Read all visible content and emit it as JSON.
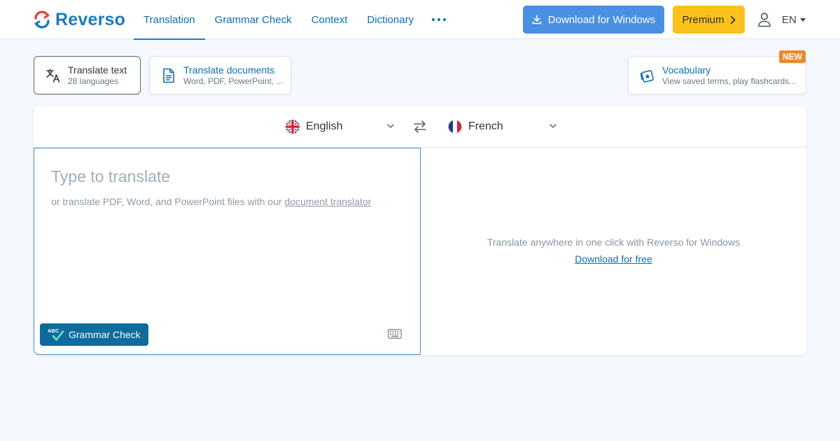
{
  "header": {
    "logo_text": "Reverso",
    "nav": [
      {
        "label": "Translation",
        "active": true
      },
      {
        "label": "Grammar Check",
        "active": false
      },
      {
        "label": "Context",
        "active": false
      },
      {
        "label": "Dictionary",
        "active": false
      }
    ],
    "more_icon": "ellipsis-icon",
    "download_label": "Download for Windows",
    "premium_label": "Premium",
    "ui_language": "EN"
  },
  "modes": {
    "text": {
      "title": "Translate text",
      "subtitle": "28 languages"
    },
    "documents": {
      "title": "Translate documents",
      "subtitle": "Word, PDF, PowerPoint, ..."
    },
    "vocabulary": {
      "title": "Vocabulary",
      "subtitle": "View saved terms, play flashcards...",
      "badge": "NEW"
    }
  },
  "translator": {
    "source_language": "English",
    "target_language": "French",
    "placeholder": "Type to translate",
    "hint_prefix": "or translate PDF, Word, and PowerPoint files with our",
    "hint_link": "document translator",
    "grammar_button": "Grammar Check",
    "grammar_icon_text": "ABC",
    "promo_text": "Translate anywhere in one click with Reverso for Windows",
    "promo_link": "Download for free"
  },
  "colors": {
    "brand_blue": "#1a7cbd",
    "download_button": "#4a90e2",
    "premium_button": "#fcc21b",
    "new_badge": "#f0892a",
    "grammar_button": "#0e6b9e",
    "page_background": "#f5f8fc"
  }
}
